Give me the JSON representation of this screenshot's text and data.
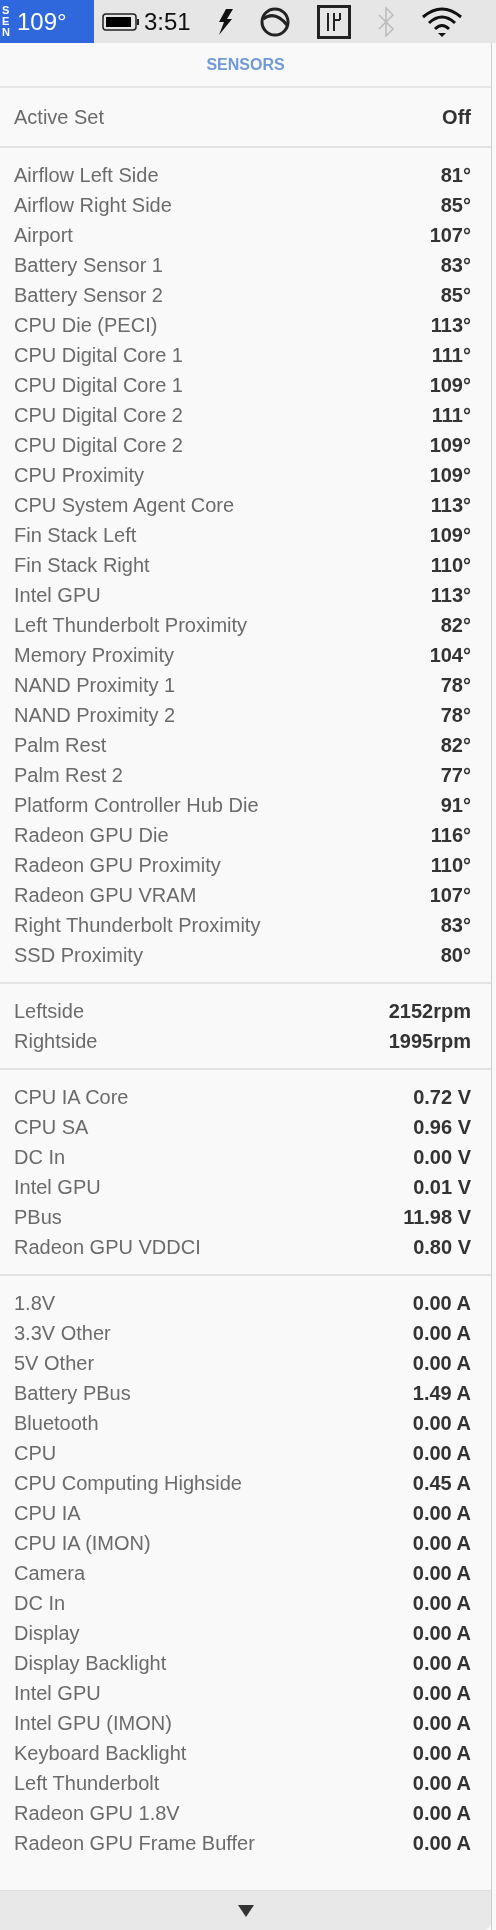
{
  "menu_bar": {
    "app_label": "SEN",
    "temperature": "109°",
    "clock": "3:51"
  },
  "header": "SENSORS",
  "active_set": {
    "label": "Active Set",
    "value": "Off"
  },
  "sections": [
    {
      "rows": [
        {
          "label": "Airflow Left Side",
          "value": "81°"
        },
        {
          "label": "Airflow Right Side",
          "value": "85°"
        },
        {
          "label": "Airport",
          "value": "107°"
        },
        {
          "label": "Battery Sensor 1",
          "value": "83°"
        },
        {
          "label": "Battery Sensor 2",
          "value": "85°"
        },
        {
          "label": "CPU Die (PECI)",
          "value": "113°"
        },
        {
          "label": "CPU Digital Core 1",
          "value": "111°"
        },
        {
          "label": "CPU Digital Core 1",
          "value": "109°"
        },
        {
          "label": "CPU Digital Core 2",
          "value": "111°"
        },
        {
          "label": "CPU Digital Core 2",
          "value": "109°"
        },
        {
          "label": "CPU Proximity",
          "value": "109°"
        },
        {
          "label": "CPU System Agent Core",
          "value": "113°"
        },
        {
          "label": "Fin Stack Left",
          "value": "109°"
        },
        {
          "label": "Fin Stack Right",
          "value": "110°"
        },
        {
          "label": "Intel GPU",
          "value": "113°"
        },
        {
          "label": "Left Thunderbolt Proximity",
          "value": "82°"
        },
        {
          "label": "Memory Proximity",
          "value": "104°"
        },
        {
          "label": "NAND Proximity 1",
          "value": "78°"
        },
        {
          "label": "NAND Proximity 2",
          "value": "78°"
        },
        {
          "label": "Palm Rest",
          "value": "82°"
        },
        {
          "label": "Palm Rest 2",
          "value": "77°"
        },
        {
          "label": "Platform Controller Hub Die",
          "value": "91°"
        },
        {
          "label": "Radeon GPU Die",
          "value": "116°"
        },
        {
          "label": "Radeon GPU Proximity",
          "value": "110°"
        },
        {
          "label": "Radeon GPU VRAM",
          "value": "107°"
        },
        {
          "label": "Right Thunderbolt Proximity",
          "value": "83°"
        },
        {
          "label": "SSD Proximity",
          "value": "80°"
        }
      ]
    },
    {
      "rows": [
        {
          "label": "Leftside",
          "value": "2152rpm"
        },
        {
          "label": "Rightside",
          "value": "1995rpm"
        }
      ]
    },
    {
      "rows": [
        {
          "label": "CPU IA Core",
          "value": "0.72 V"
        },
        {
          "label": "CPU SA",
          "value": "0.96 V"
        },
        {
          "label": "DC In",
          "value": "0.00 V"
        },
        {
          "label": "Intel GPU",
          "value": "0.01 V"
        },
        {
          "label": "PBus",
          "value": "11.98 V"
        },
        {
          "label": "Radeon GPU VDDCI",
          "value": "0.80 V"
        }
      ]
    },
    {
      "rows": [
        {
          "label": "1.8V",
          "value": "0.00 A"
        },
        {
          "label": "3.3V Other",
          "value": "0.00 A"
        },
        {
          "label": "5V Other",
          "value": "0.00 A"
        },
        {
          "label": "Battery PBus",
          "value": "1.49 A"
        },
        {
          "label": "Bluetooth",
          "value": "0.00 A"
        },
        {
          "label": "CPU",
          "value": "0.00 A"
        },
        {
          "label": "CPU Computing Highside",
          "value": "0.45 A"
        },
        {
          "label": "CPU IA",
          "value": "0.00 A"
        },
        {
          "label": "CPU IA (IMON)",
          "value": "0.00 A"
        },
        {
          "label": "Camera",
          "value": "0.00 A"
        },
        {
          "label": "DC In",
          "value": "0.00 A"
        },
        {
          "label": "Display",
          "value": "0.00 A"
        },
        {
          "label": "Display Backlight",
          "value": "0.00 A"
        },
        {
          "label": "Intel GPU",
          "value": "0.00 A"
        },
        {
          "label": "Intel GPU (IMON)",
          "value": "0.00 A"
        },
        {
          "label": "Keyboard Backlight",
          "value": "0.00 A"
        },
        {
          "label": "Left Thunderbolt",
          "value": "0.00 A"
        },
        {
          "label": "Radeon GPU 1.8V",
          "value": "0.00 A"
        },
        {
          "label": "Radeon GPU Frame Buffer",
          "value": "0.00 A"
        }
      ]
    }
  ]
}
